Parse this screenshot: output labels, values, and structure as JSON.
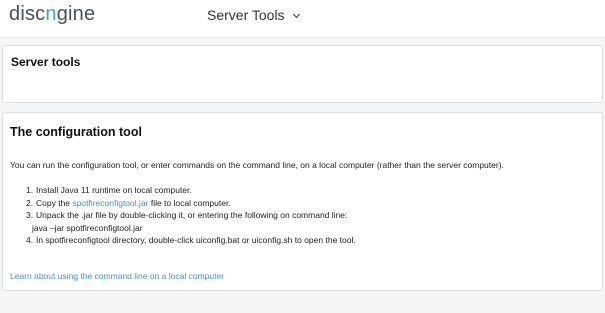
{
  "header": {
    "logo_part1": "disc",
    "logo_part2": "n",
    "logo_part3": "gine",
    "menu_label": "Server Tools"
  },
  "server_panel": {
    "title": "Server tools"
  },
  "config_panel": {
    "title": "The configuration tool",
    "intro": "You can run the configuration tool, or enter commands on the command line, on a local computer (rather than the server computer).",
    "steps": [
      {
        "num": "1.",
        "text": "Install Java 11 runtime on local computer."
      },
      {
        "num": "2.",
        "pre": "Copy the ",
        "link": "spotfireconfigtool.jar",
        "post": " file to local computer."
      },
      {
        "num": "3.",
        "text": "Unpack the .jar file by double-clicking it, or entering the following on command line:",
        "sub": "java –jar spotfireconfigtool.jar"
      },
      {
        "num": "4.",
        "text": "In spotfireconfigtool directory, double-click uiconfig.bat or uiconfig.sh to open the tool."
      }
    ],
    "learn_link": "Learn about using the command line on a local computer"
  },
  "colors": {
    "logo_accent": "#35a7c8",
    "link": "#4a90c8",
    "page_background": "#f4f5f6"
  },
  "icons": {
    "menu_chevron": "chevron-down-icon"
  }
}
